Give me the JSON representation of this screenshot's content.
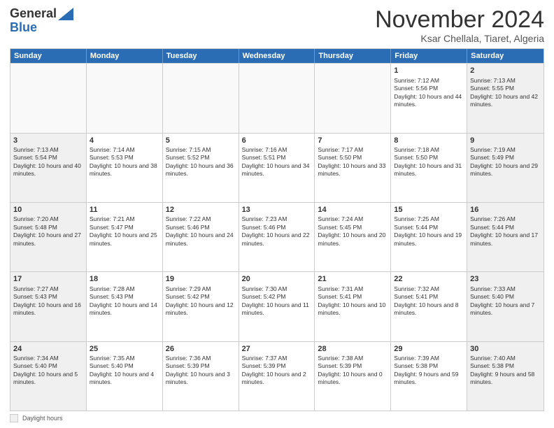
{
  "logo": {
    "general": "General",
    "blue": "Blue"
  },
  "title": "November 2024",
  "location": "Ksar Chellala, Tiaret, Algeria",
  "days_of_week": [
    "Sunday",
    "Monday",
    "Tuesday",
    "Wednesday",
    "Thursday",
    "Friday",
    "Saturday"
  ],
  "legend_label": "Daylight hours",
  "weeks": [
    [
      {
        "day": "",
        "info": "",
        "empty": true
      },
      {
        "day": "",
        "info": "",
        "empty": true
      },
      {
        "day": "",
        "info": "",
        "empty": true
      },
      {
        "day": "",
        "info": "",
        "empty": true
      },
      {
        "day": "",
        "info": "",
        "empty": true
      },
      {
        "day": "1",
        "info": "Sunrise: 7:12 AM\nSunset: 5:56 PM\nDaylight: 10 hours and 44 minutes."
      },
      {
        "day": "2",
        "info": "Sunrise: 7:13 AM\nSunset: 5:55 PM\nDaylight: 10 hours and 42 minutes."
      }
    ],
    [
      {
        "day": "3",
        "info": "Sunrise: 7:13 AM\nSunset: 5:54 PM\nDaylight: 10 hours and 40 minutes."
      },
      {
        "day": "4",
        "info": "Sunrise: 7:14 AM\nSunset: 5:53 PM\nDaylight: 10 hours and 38 minutes."
      },
      {
        "day": "5",
        "info": "Sunrise: 7:15 AM\nSunset: 5:52 PM\nDaylight: 10 hours and 36 minutes."
      },
      {
        "day": "6",
        "info": "Sunrise: 7:16 AM\nSunset: 5:51 PM\nDaylight: 10 hours and 34 minutes."
      },
      {
        "day": "7",
        "info": "Sunrise: 7:17 AM\nSunset: 5:50 PM\nDaylight: 10 hours and 33 minutes."
      },
      {
        "day": "8",
        "info": "Sunrise: 7:18 AM\nSunset: 5:50 PM\nDaylight: 10 hours and 31 minutes."
      },
      {
        "day": "9",
        "info": "Sunrise: 7:19 AM\nSunset: 5:49 PM\nDaylight: 10 hours and 29 minutes."
      }
    ],
    [
      {
        "day": "10",
        "info": "Sunrise: 7:20 AM\nSunset: 5:48 PM\nDaylight: 10 hours and 27 minutes."
      },
      {
        "day": "11",
        "info": "Sunrise: 7:21 AM\nSunset: 5:47 PM\nDaylight: 10 hours and 25 minutes."
      },
      {
        "day": "12",
        "info": "Sunrise: 7:22 AM\nSunset: 5:46 PM\nDaylight: 10 hours and 24 minutes."
      },
      {
        "day": "13",
        "info": "Sunrise: 7:23 AM\nSunset: 5:46 PM\nDaylight: 10 hours and 22 minutes."
      },
      {
        "day": "14",
        "info": "Sunrise: 7:24 AM\nSunset: 5:45 PM\nDaylight: 10 hours and 20 minutes."
      },
      {
        "day": "15",
        "info": "Sunrise: 7:25 AM\nSunset: 5:44 PM\nDaylight: 10 hours and 19 minutes."
      },
      {
        "day": "16",
        "info": "Sunrise: 7:26 AM\nSunset: 5:44 PM\nDaylight: 10 hours and 17 minutes."
      }
    ],
    [
      {
        "day": "17",
        "info": "Sunrise: 7:27 AM\nSunset: 5:43 PM\nDaylight: 10 hours and 16 minutes."
      },
      {
        "day": "18",
        "info": "Sunrise: 7:28 AM\nSunset: 5:43 PM\nDaylight: 10 hours and 14 minutes."
      },
      {
        "day": "19",
        "info": "Sunrise: 7:29 AM\nSunset: 5:42 PM\nDaylight: 10 hours and 12 minutes."
      },
      {
        "day": "20",
        "info": "Sunrise: 7:30 AM\nSunset: 5:42 PM\nDaylight: 10 hours and 11 minutes."
      },
      {
        "day": "21",
        "info": "Sunrise: 7:31 AM\nSunset: 5:41 PM\nDaylight: 10 hours and 10 minutes."
      },
      {
        "day": "22",
        "info": "Sunrise: 7:32 AM\nSunset: 5:41 PM\nDaylight: 10 hours and 8 minutes."
      },
      {
        "day": "23",
        "info": "Sunrise: 7:33 AM\nSunset: 5:40 PM\nDaylight: 10 hours and 7 minutes."
      }
    ],
    [
      {
        "day": "24",
        "info": "Sunrise: 7:34 AM\nSunset: 5:40 PM\nDaylight: 10 hours and 5 minutes."
      },
      {
        "day": "25",
        "info": "Sunrise: 7:35 AM\nSunset: 5:40 PM\nDaylight: 10 hours and 4 minutes."
      },
      {
        "day": "26",
        "info": "Sunrise: 7:36 AM\nSunset: 5:39 PM\nDaylight: 10 hours and 3 minutes."
      },
      {
        "day": "27",
        "info": "Sunrise: 7:37 AM\nSunset: 5:39 PM\nDaylight: 10 hours and 2 minutes."
      },
      {
        "day": "28",
        "info": "Sunrise: 7:38 AM\nSunset: 5:39 PM\nDaylight: 10 hours and 0 minutes."
      },
      {
        "day": "29",
        "info": "Sunrise: 7:39 AM\nSunset: 5:38 PM\nDaylight: 9 hours and 59 minutes."
      },
      {
        "day": "30",
        "info": "Sunrise: 7:40 AM\nSunset: 5:38 PM\nDaylight: 9 hours and 58 minutes."
      }
    ]
  ]
}
